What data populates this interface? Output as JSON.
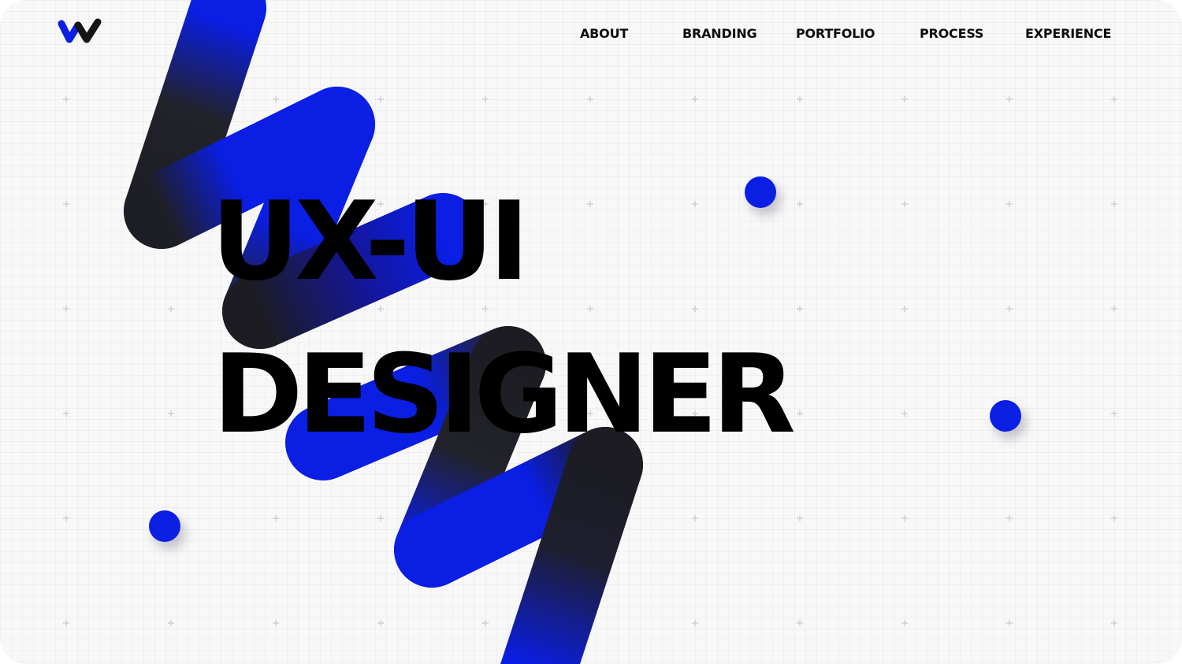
{
  "brand": {
    "logo_icon": "w-logo-icon",
    "colors": {
      "accent": "#0a1ee4",
      "dark": "#1a1a1a",
      "background": "#f8f8f9",
      "text": "#0d0d0d"
    }
  },
  "nav": {
    "items": [
      {
        "label": "ABOUT"
      },
      {
        "label": "BRANDING"
      },
      {
        "label": "PORTFOLIO"
      },
      {
        "label": "PROCESS"
      },
      {
        "label": "EXPERIENCE"
      }
    ]
  },
  "hero": {
    "line1": "UX-UI",
    "line2": "DESIGNER"
  }
}
